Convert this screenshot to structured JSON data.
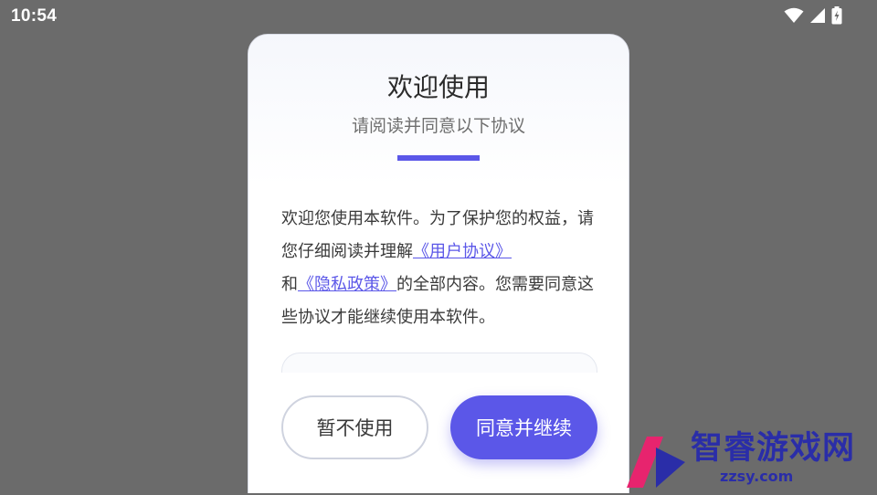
{
  "status_bar": {
    "time": "10:54",
    "icons": [
      "wifi-icon",
      "signal-icon",
      "battery-charging-icon"
    ]
  },
  "dialog": {
    "title": "欢迎使用",
    "subtitle": "请阅读并同意以下协议",
    "body": {
      "text_1": "欢迎您使用本软件。为了保护您的权益，请您仔细阅读并理解",
      "user_agreement_link": "《用户协议》",
      "text_2": "和",
      "privacy_policy_link": "《隐私政策》",
      "text_3": "的全部内容。您需要同意这些协议才能继续使用本软件。"
    },
    "buttons": {
      "decline_label": "暂不使用",
      "accept_label": "同意并继续"
    }
  },
  "watermark": {
    "title": "智睿游戏网",
    "url": "zzsy.com"
  },
  "colors": {
    "accent": "#5b57e8",
    "overlay": "#6b6b6b",
    "watermark": "#2a2da8"
  }
}
